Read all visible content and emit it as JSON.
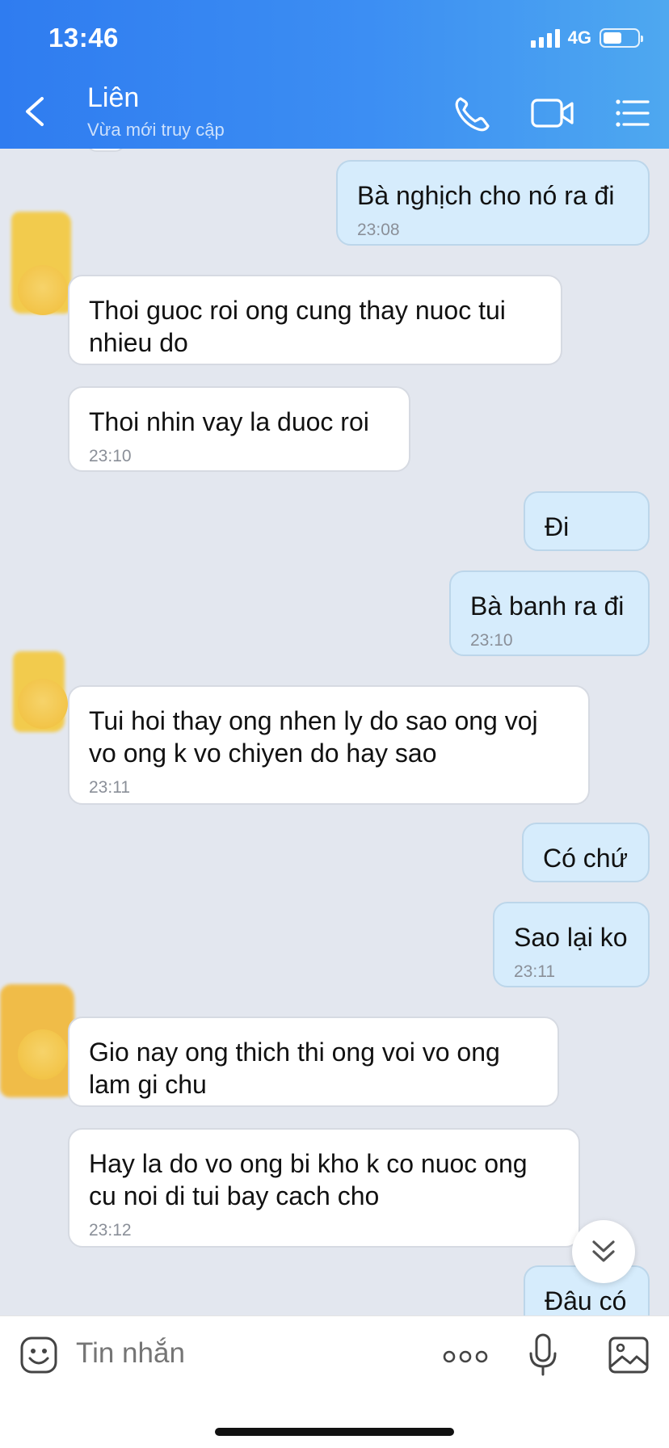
{
  "status_bar": {
    "time": "13:46",
    "network": "4G",
    "battery_level": 0.55
  },
  "header": {
    "contact_name": "Liên",
    "contact_status": "Vừa mới truy cập",
    "icons": [
      "back-arrow-icon",
      "phone-icon",
      "video-camera-icon",
      "list-menu-icon"
    ]
  },
  "messages": [
    {
      "side": "sent",
      "text": "Bà nghịch cho nó ra đi",
      "time": "23:08"
    },
    {
      "side": "recv",
      "text": "Thoi guoc roi ong cung thay nuoc tui nhieu do",
      "time": ""
    },
    {
      "side": "recv",
      "text": "Thoi nhin vay la duoc roi",
      "time": "23:10"
    },
    {
      "side": "sent",
      "text": "Đi",
      "time": ""
    },
    {
      "side": "sent",
      "text": "Bà banh ra đi",
      "time": "23:10"
    },
    {
      "side": "recv",
      "text": "Tui hoi thay ong nhen ly do sao ong voj vo ong k vo chiyen do hay sao",
      "time": "23:11"
    },
    {
      "side": "sent",
      "text": "Có chứ",
      "time": ""
    },
    {
      "side": "sent",
      "text": "Sao lại ko",
      "time": "23:11"
    },
    {
      "side": "recv",
      "text": "Gio nay ong thich thi ong voi vo ong lam gi chu",
      "time": ""
    },
    {
      "side": "recv",
      "text": "Hay la do vo ong bi kho k co nuoc ong cu noi di tui bay cach cho",
      "time": "23:12"
    },
    {
      "side": "sent",
      "text": "Đâu có",
      "time": ""
    }
  ],
  "input_bar": {
    "placeholder": "Tin nhắn",
    "icons": [
      "emoji-icon",
      "more-icon",
      "microphone-icon",
      "image-icon"
    ]
  },
  "colors": {
    "header_start": "#2f7cf0",
    "header_end": "#4ea8f0",
    "sent_bubble": "#d6ecfc",
    "chat_bg": "#e3e7ef"
  }
}
